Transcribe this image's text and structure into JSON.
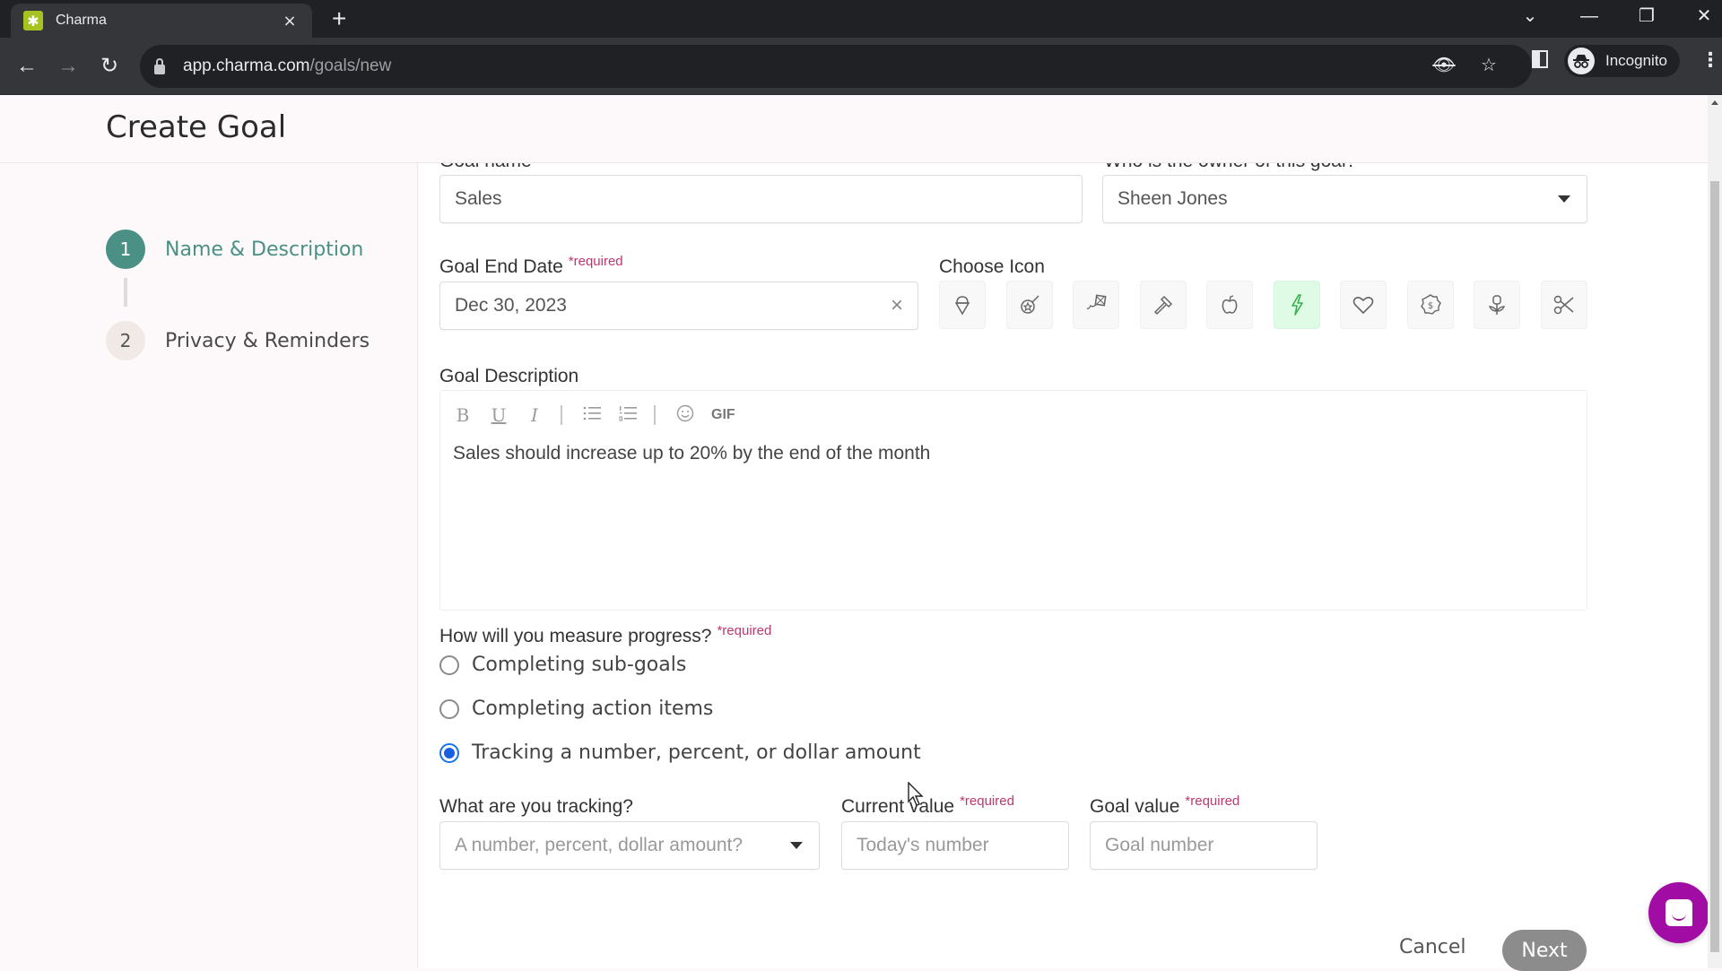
{
  "browser": {
    "tab_title": "Charma",
    "tab_favicon": "charma-logo-icon",
    "url_host": "app.charma.com",
    "url_path": "/goals/new",
    "profile_label": "Incognito",
    "controls": {
      "close_tab": "×",
      "new_tab": "+",
      "back": "←",
      "forward": "→",
      "reload": "↻",
      "tab_search": "⌄",
      "minimize": "—",
      "restore": "❐",
      "close_window": "✕",
      "eye_slash": "👁",
      "star": "☆",
      "menu": "⋮"
    }
  },
  "page": {
    "title": "Create Goal"
  },
  "stepper": {
    "steps": [
      {
        "number": "1",
        "label": "Name & Description",
        "state": "active"
      },
      {
        "number": "2",
        "label": "Privacy & Reminders",
        "state": "inactive"
      }
    ]
  },
  "form": {
    "required_marker": "*required",
    "goal_name": {
      "label": "Goal name",
      "value": "Sales"
    },
    "owner": {
      "label": "Who is the owner of this goal?",
      "value": "Sheen Jones"
    },
    "end_date": {
      "label": "Goal End Date",
      "value": "Dec 30, 2023",
      "clear": "×"
    },
    "choose_icon": {
      "label": "Choose Icon",
      "icons": [
        {
          "name": "ice-cream-icon",
          "selected": false
        },
        {
          "name": "shooting-star-icon",
          "selected": false
        },
        {
          "name": "kite-icon",
          "selected": false
        },
        {
          "name": "hammer-icon",
          "selected": false
        },
        {
          "name": "apple-icon",
          "selected": false
        },
        {
          "name": "lightning-icon",
          "selected": true
        },
        {
          "name": "heart-icon",
          "selected": false
        },
        {
          "name": "dollar-badge-icon",
          "selected": false
        },
        {
          "name": "flower-icon",
          "selected": false
        },
        {
          "name": "scissors-icon",
          "selected": false
        }
      ]
    },
    "description": {
      "label": "Goal Description",
      "toolbar": {
        "bold": "B",
        "underline": "U",
        "italic": "I",
        "bullet_list": "☰",
        "numbered_list": "☰",
        "emoji": "☺",
        "gif": "GIF"
      },
      "value": "Sales should increase up to 20% by the end of the month"
    },
    "measure": {
      "label": "How will you measure progress?",
      "options": [
        {
          "label": "Completing sub-goals",
          "checked": false
        },
        {
          "label": "Completing action items",
          "checked": false
        },
        {
          "label": "Tracking a number, percent, or dollar amount",
          "checked": true
        }
      ]
    },
    "tracking": {
      "label": "What are you tracking?",
      "placeholder": "A number, percent, dollar amount?"
    },
    "current_value": {
      "label": "Current value",
      "placeholder": "Today's number"
    },
    "goal_value": {
      "label": "Goal value",
      "placeholder": "Goal number"
    }
  },
  "actions": {
    "cancel": "Cancel",
    "next": "Next"
  },
  "colors": {
    "accent_teal": "#4a9085",
    "required_pink": "#c0366e",
    "selected_icon_bg": "#dffbe6",
    "radio_blue": "#1a5fe0",
    "chat_purple": "#a10da4",
    "next_disabled": "#8c8c8c"
  }
}
